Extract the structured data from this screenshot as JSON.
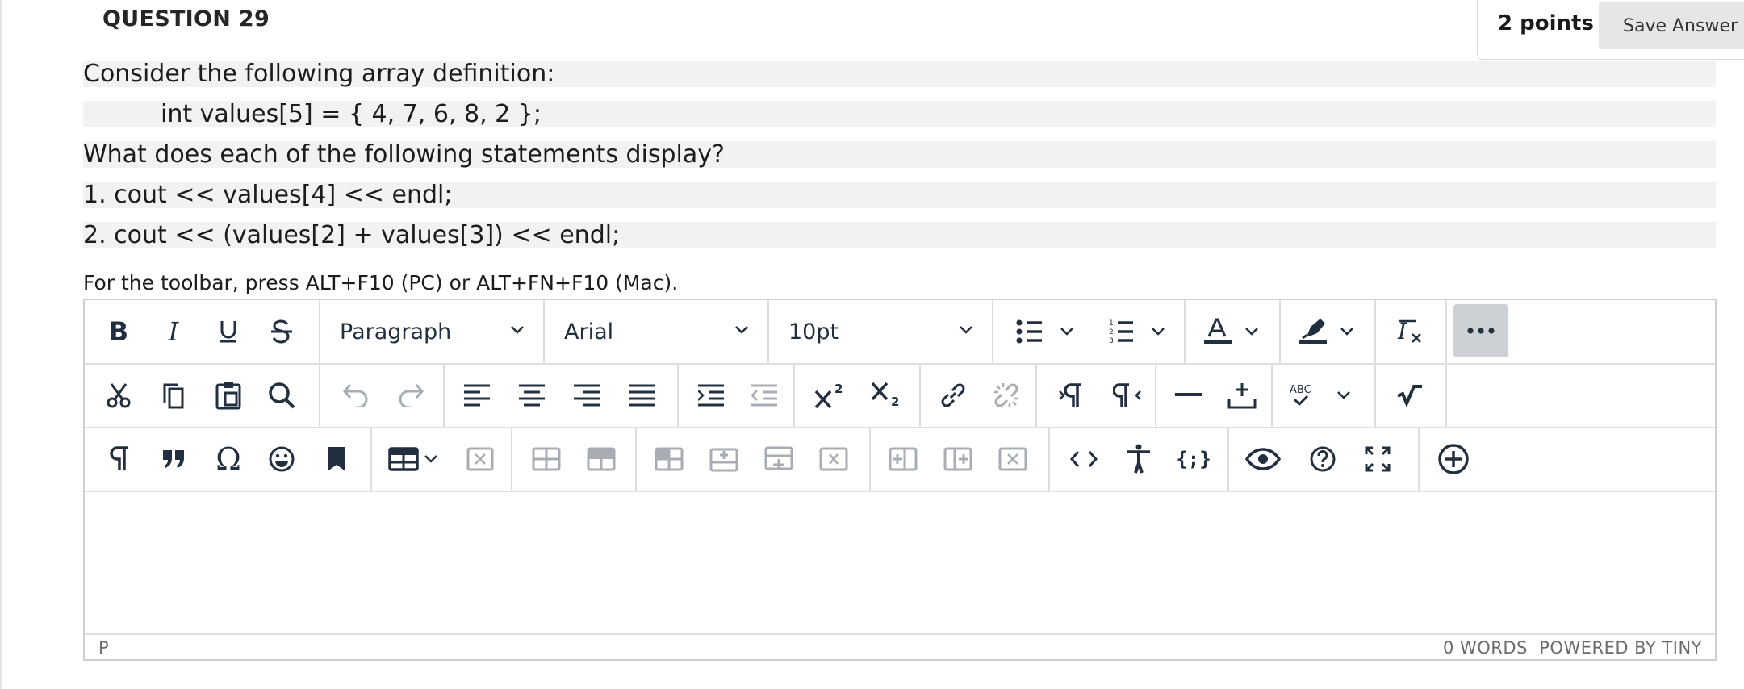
{
  "question": {
    "title": "QUESTION 29",
    "points": "2 points",
    "save_label": "Save Answer",
    "lines": [
      "Consider the following array definition:",
      "int values[5] = { 4, 7, 6, 8, 2 };",
      "What does each of the following statements display?",
      "1. cout << values[4] << endl;",
      "2. cout << (values[2] + values[3]) << endl;"
    ]
  },
  "editor": {
    "hint": "For the toolbar, press ALT+F10 (PC) or ALT+FN+F10 (Mac).",
    "block_format": "Paragraph",
    "font_family": "Arial",
    "font_size": "10pt",
    "status_path": "P",
    "word_count": "0 WORDS",
    "powered_by": "POWERED BY TINY",
    "toolbar_row1": [
      "bold-icon",
      "italic-icon",
      "underline-icon",
      "strikethrough-icon",
      "bullet-list-icon",
      "numbered-list-icon",
      "text-color-icon",
      "highlight-color-icon",
      "clear-formatting-icon",
      "more-icon"
    ],
    "toolbar_row2": [
      "cut-icon",
      "copy-icon",
      "paste-icon",
      "find-icon",
      "undo-icon",
      "redo-icon",
      "align-left-icon",
      "align-center-icon",
      "align-right-icon",
      "justify-icon",
      "indent-icon",
      "outdent-icon",
      "superscript-icon",
      "subscript-icon",
      "link-icon",
      "unlink-icon",
      "ltr-icon",
      "rtl-icon",
      "horizontal-rule-icon",
      "insert-anchor-icon",
      "spellcheck-icon",
      "math-icon"
    ],
    "toolbar_row3": [
      "paragraph-mark-icon",
      "blockquote-icon",
      "special-char-icon",
      "emoji-icon",
      "bookmark-icon",
      "table-icon",
      "delete-table-icon",
      "table-row-icon",
      "table-cell-icon",
      "table-merge-icon",
      "insert-row-before-icon",
      "insert-row-after-icon",
      "delete-row-icon",
      "insert-col-before-icon",
      "insert-col-after-icon",
      "delete-col-icon",
      "source-code-icon",
      "accessibility-icon",
      "template-icon",
      "preview-icon",
      "help-icon",
      "fullscreen-icon",
      "add-content-icon"
    ]
  },
  "colors": {
    "toolbar_icon": "#222f3e",
    "disabled_icon": "#a8adb3",
    "border": "#dedede",
    "line_bg": "#f2f2f2"
  }
}
